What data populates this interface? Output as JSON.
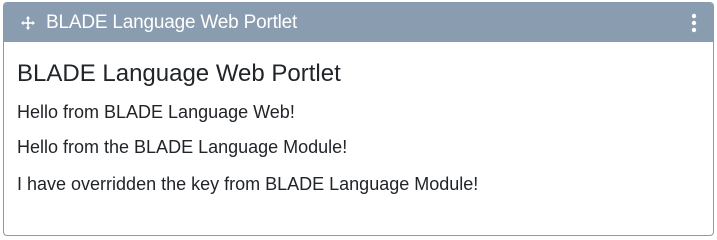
{
  "topper": {
    "title": "BLADE Language Web Portlet",
    "move_icon": "move-arrows-icon",
    "options_icon": "vertical-ellipsis-icon",
    "background_color": "#8a9cb0",
    "text_color": "#ffffff"
  },
  "portlet": {
    "title": "BLADE Language Web Portlet",
    "messages": [
      "Hello from BLADE Language Web!",
      "Hello from the BLADE Language Module!",
      "I have overridden the key from BLADE Language Module!"
    ]
  }
}
